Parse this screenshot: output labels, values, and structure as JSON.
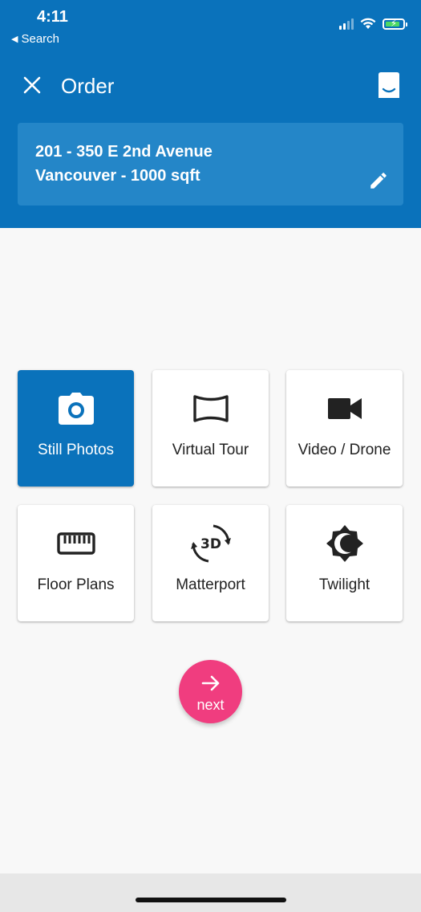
{
  "status_bar": {
    "time": "4:11",
    "back_label": "Search",
    "back_icon": "back-triangle-icon"
  },
  "toolbar": {
    "title": "Order",
    "close_icon": "close-icon",
    "chat_icon": "chat-icon"
  },
  "address": {
    "line1": "201 - 350 E 2nd Avenue",
    "line2": "Vancouver - 1000 sqft",
    "edit_icon": "pencil-icon"
  },
  "services": [
    {
      "label": "Still Photos",
      "icon": "camera-icon",
      "selected": true
    },
    {
      "label": "Virtual Tour",
      "icon": "panorama-icon",
      "selected": false
    },
    {
      "label": "Video / Drone",
      "icon": "videocam-icon",
      "selected": false
    },
    {
      "label": "Floor Plans",
      "icon": "ruler-icon",
      "selected": false
    },
    {
      "label": "Matterport",
      "icon": "3d-rotation-icon",
      "selected": false
    },
    {
      "label": "Twilight",
      "icon": "night-mode-icon",
      "selected": false
    }
  ],
  "next_button": {
    "label": "next",
    "icon": "arrow-right-icon"
  },
  "colors": {
    "primary": "#0a72bb",
    "address_card": "#2486c8",
    "accent": "#f03d7f",
    "background": "#f8f8f8"
  }
}
